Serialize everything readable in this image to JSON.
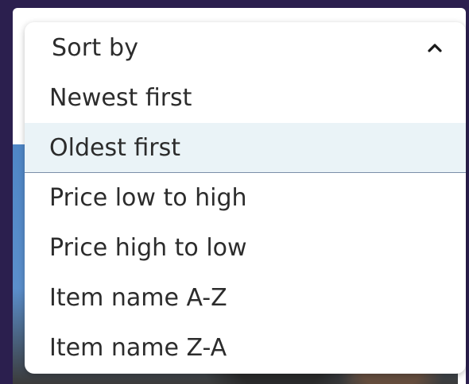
{
  "sort_dropdown": {
    "label": "Sort by",
    "expanded": true,
    "chevron_icon": "chevron-up-icon",
    "options": [
      {
        "label": "Newest first",
        "highlighted": false
      },
      {
        "label": "Oldest first",
        "highlighted": true
      },
      {
        "label": "Price low to high",
        "highlighted": false
      },
      {
        "label": "Price high to low",
        "highlighted": false
      },
      {
        "label": "Item name A-Z",
        "highlighted": false
      },
      {
        "label": "Item name Z-A",
        "highlighted": false
      }
    ]
  },
  "colors": {
    "backdrop": "#2b1f4e",
    "highlight": "#eaf3f7",
    "text": "#2c2c2c"
  }
}
